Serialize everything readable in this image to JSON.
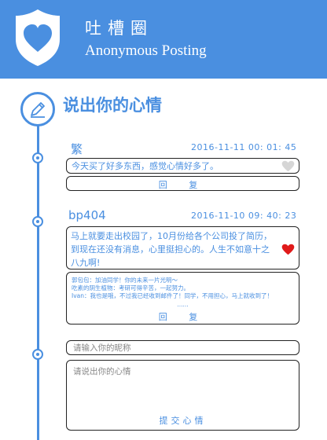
{
  "header": {
    "brand_cn": "吐槽圈",
    "brand_en": "Anonymous Posting",
    "accent": "#4a8fe0"
  },
  "section": {
    "title": "说出你的心情",
    "icon": "pencil-icon"
  },
  "posts": [
    {
      "user": "繁",
      "time": "2016-11-11 00: 01: 45",
      "message": "今天买了好多东西，感觉心情好多了。",
      "liked": false,
      "reply_label": "回 复",
      "comments": []
    },
    {
      "user": "bp404",
      "time": "2016-11-10 09: 40: 23",
      "message": "马上就要走出校园了，10月份给各个公司投了简历，到现在还没有消息，心里挺担心的。人生不如意十之八九啊!",
      "liked": true,
      "comments": [
        "郭包包：加油同学！你的未来一片光明～",
        "吃素的阴生植物：考研可得辛苦，一起努力。",
        "Ivan：我也是哦，不过我已经收到邮件了！同学，不用担心，马上就收到了！"
      ],
      "more": "......",
      "reply_label": "回 复"
    }
  ],
  "form": {
    "nickname_placeholder": "请输入你的昵称",
    "content_placeholder": "请说出你的心情",
    "submit_label": "提交心情"
  }
}
